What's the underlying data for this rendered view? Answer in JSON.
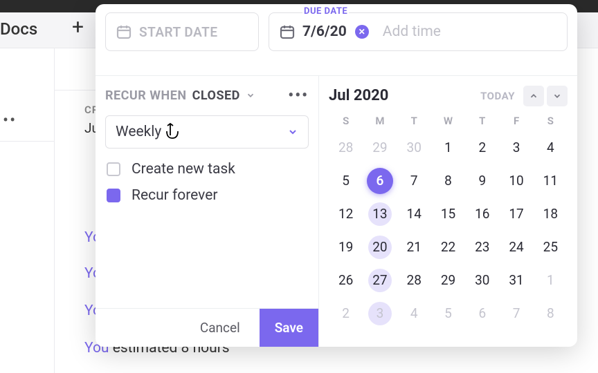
{
  "background": {
    "docs": "Docs",
    "plus": "+",
    "cr": "CR",
    "ju": "Ju",
    "you1": "Yo",
    "you2": "Yo",
    "you3": "Yo",
    "you4_y": "You",
    "you4_rest": " estimated 8 hours"
  },
  "date": {
    "start_placeholder": "START DATE",
    "due_label": "DUE DATE",
    "due_value": "7/6/20",
    "add_time": "Add time"
  },
  "recur": {
    "when": "RECUR WHEN",
    "closed": "CLOSED",
    "frequency": "Weekly",
    "create_new": "Create new task",
    "forever": "Recur forever"
  },
  "buttons": {
    "cancel": "Cancel",
    "save": "Save"
  },
  "calendar": {
    "title": "Jul 2020",
    "today": "TODAY",
    "dow": [
      "S",
      "M",
      "T",
      "W",
      "T",
      "F",
      "S"
    ],
    "weeks": [
      [
        {
          "n": "28",
          "muted": true
        },
        {
          "n": "29",
          "muted": true
        },
        {
          "n": "30",
          "muted": true
        },
        {
          "n": "1"
        },
        {
          "n": "2"
        },
        {
          "n": "3"
        },
        {
          "n": "4"
        }
      ],
      [
        {
          "n": "5"
        },
        {
          "n": "6",
          "sel": true
        },
        {
          "n": "7"
        },
        {
          "n": "8"
        },
        {
          "n": "9"
        },
        {
          "n": "10"
        },
        {
          "n": "11"
        }
      ],
      [
        {
          "n": "12"
        },
        {
          "n": "13",
          "hl": true
        },
        {
          "n": "14"
        },
        {
          "n": "15"
        },
        {
          "n": "16"
        },
        {
          "n": "17"
        },
        {
          "n": "18"
        }
      ],
      [
        {
          "n": "19"
        },
        {
          "n": "20",
          "hl": true
        },
        {
          "n": "21"
        },
        {
          "n": "22"
        },
        {
          "n": "23"
        },
        {
          "n": "24"
        },
        {
          "n": "25"
        }
      ],
      [
        {
          "n": "26"
        },
        {
          "n": "27",
          "hl": true
        },
        {
          "n": "28"
        },
        {
          "n": "29"
        },
        {
          "n": "30"
        },
        {
          "n": "31"
        },
        {
          "n": "1",
          "muted": true
        }
      ],
      [
        {
          "n": "2",
          "muted": true
        },
        {
          "n": "3",
          "hl": true,
          "muted": true
        },
        {
          "n": "4",
          "muted": true
        },
        {
          "n": "5",
          "muted": true
        },
        {
          "n": "6",
          "muted": true
        },
        {
          "n": "7",
          "muted": true
        },
        {
          "n": "8",
          "muted": true
        }
      ]
    ]
  }
}
